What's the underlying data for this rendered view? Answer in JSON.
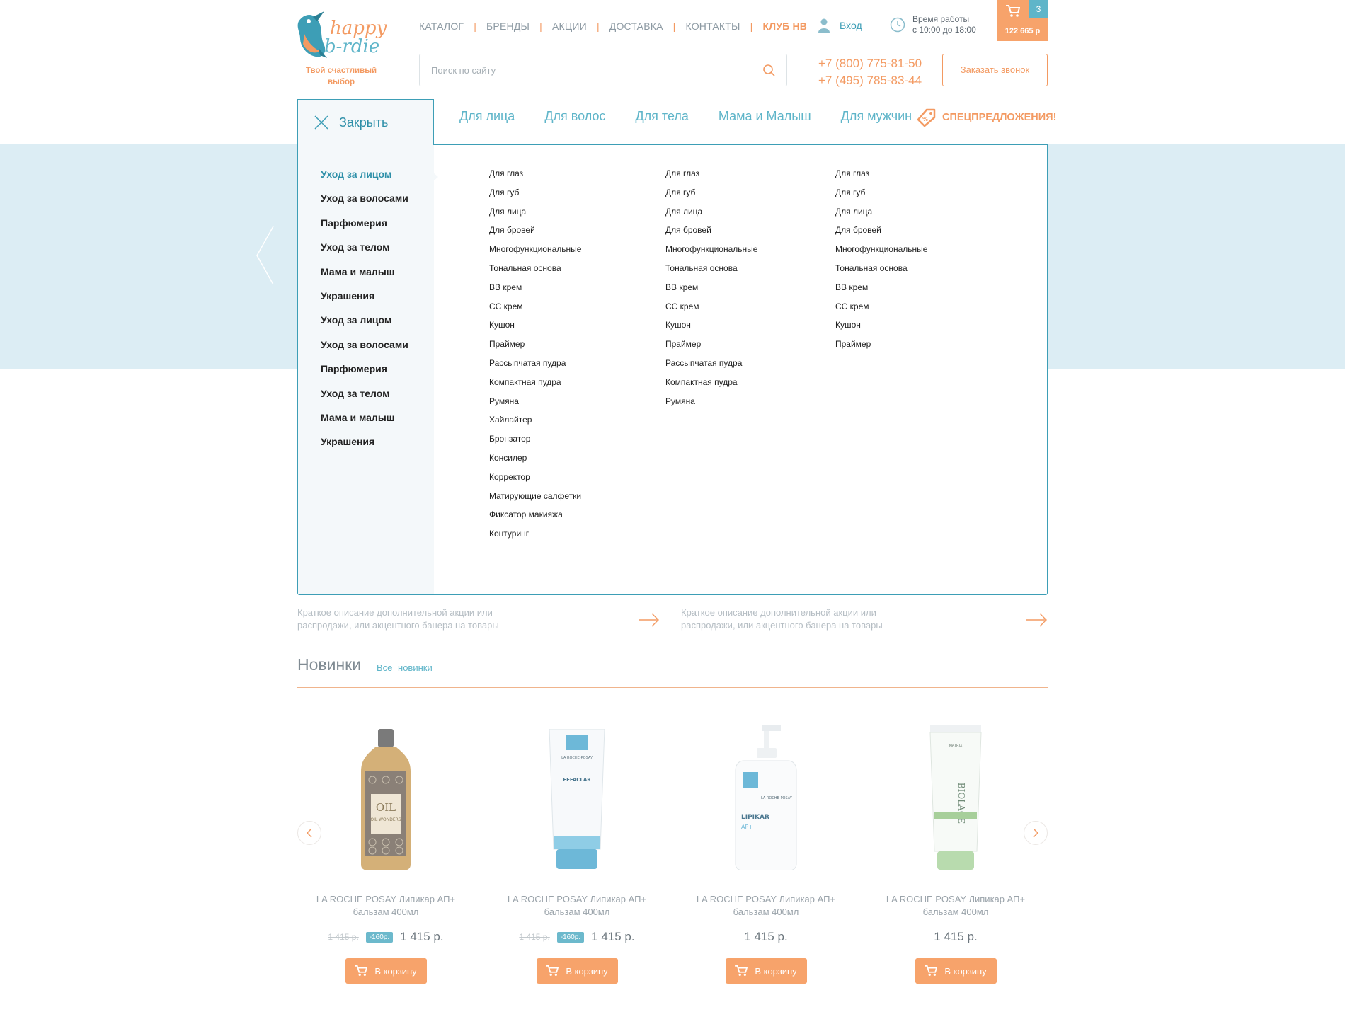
{
  "brand": {
    "tagline": "Твой счастливый выбор"
  },
  "topnav": [
    "КАТАЛОГ",
    "БРЕНДЫ",
    "АКЦИИ",
    "ДОСТАВКА",
    "КОНТАКТЫ",
    "КЛУБ HB"
  ],
  "login": "Вход",
  "hours": {
    "line1": "Время работы",
    "line2": "с 10:00 до 18:00"
  },
  "cart": {
    "count": "3",
    "sum": "122 665 р"
  },
  "search": {
    "placeholder": "Поиск по сайту"
  },
  "phones": [
    "+7 (800) 775-81-50",
    "+7 (495) 785-83-44"
  ],
  "callback": "Заказать звонок",
  "close_label": "Закрыть",
  "categories": [
    "Для лица",
    "Для волос",
    "Для тела",
    "Мама и Малыш",
    "Для мужчин"
  ],
  "special": "СПЕЦПРЕДЛОЖЕНИЯ!",
  "sidebar": [
    "Уход за лицом",
    "Уход за волосами",
    "Парфюмерия",
    "Уход за телом",
    "Мама и малыш",
    "Украшения",
    "Уход за лицом",
    "Уход за волосами",
    "Парфюмерия",
    "Уход за телом",
    "Мама и малыш",
    "Украшения"
  ],
  "sub_columns": [
    [
      "Для глаз",
      "Для губ",
      "Для лица",
      "Для бровей",
      "Многофункциональные",
      "Тональная основа",
      "BB крем",
      "CC крем",
      "Кушон",
      "Праймер",
      "Рассыпчатая пудра",
      "Компактная пудра",
      "Румяна",
      "Хайлайтер",
      "Бронзатор",
      "Консилер",
      "Корректор",
      "Матирующие салфетки",
      "Фиксатор макияжа",
      "Контуринг"
    ],
    [
      "Для глаз",
      "Для губ",
      "Для лица",
      "Для бровей",
      "Многофункциональные",
      "Тональная основа",
      "BB крем",
      "CC крем",
      "Кушон",
      "Праймер",
      "Рассыпчатая пудра",
      "Компактная пудра",
      "Румяна"
    ],
    [
      "Для глаз",
      "Для губ",
      "Для лица",
      "Для бровей",
      "Многофункциональные",
      "Тональная основа",
      "BB крем",
      "CC крем",
      "Кушон",
      "Праймер"
    ]
  ],
  "promos": [
    {
      "line1": "Краткое описание дополнительной акции или",
      "line2": "распродажи, или акцентного банера на товары"
    },
    {
      "line1": "Краткое описание дополнительной акции или",
      "line2": "распродажи, или акцентного банера на товары"
    }
  ],
  "new_section": {
    "title": "Новинки",
    "link": "Все новинки"
  },
  "products": [
    {
      "name1": "LA ROCHE POSAY Липикар АП+",
      "name2": "бальзам 400мл",
      "old": "1 415 р.",
      "discount": "-160р.",
      "price": "1 415 р.",
      "cart": "В корзину"
    },
    {
      "name1": "LA ROCHE POSAY Липикар АП+",
      "name2": "бальзам 400мл",
      "old": "1 415 р.",
      "discount": "-160р.",
      "price": "1 415 р.",
      "cart": "В корзину"
    },
    {
      "name1": "LA ROCHE POSAY Липикар АП+",
      "name2": "бальзам 400мл",
      "old": "",
      "discount": "",
      "price": "1 415 р.",
      "cart": "В корзину"
    },
    {
      "name1": "LA ROCHE POSAY Липикар АП+",
      "name2": "бальзам 400мл",
      "old": "",
      "discount": "",
      "price": "1 415 р.",
      "cart": "В корзину"
    }
  ],
  "product_labels": {
    "p1": "OIL WONDERS",
    "p2_brand": "LA ROCHE-POSAY",
    "p2_name": "EFFACLAR",
    "p3_brand": "LA ROCHE-POSAY",
    "p3_name": "LIPIKAR",
    "p4_brand": "MATRIX",
    "p4_name": "BIOLAGE"
  },
  "icons": [
    "logo-bird",
    "user-icon",
    "clock-icon",
    "cart-icon",
    "search-icon",
    "close-icon",
    "discount-tag-icon",
    "arrow-right-icon",
    "chevron-left-icon",
    "chevron-right-icon"
  ],
  "colors": {
    "accent_orange": "#f39a62",
    "accent_blue": "#3d9eb6",
    "hero_bg": "#dcedf4"
  }
}
